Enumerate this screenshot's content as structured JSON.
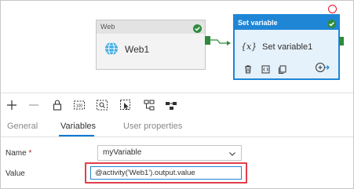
{
  "canvas": {
    "web_activity": {
      "type_label": "Web",
      "name": "Web1"
    },
    "set_variable_activity": {
      "type_label": "Set variable",
      "fx_symbol": "{x}",
      "name": "Set variable1"
    }
  },
  "toolbar": {
    "items": [
      "add-icon",
      "remove-icon",
      "lock-icon",
      "zoom-100-icon",
      "zoom-fit-icon",
      "select-icon",
      "auto-align-icon",
      "layout-icon"
    ]
  },
  "tabs": [
    {
      "label": "General",
      "active": false
    },
    {
      "label": "Variables",
      "active": true
    },
    {
      "label": "User properties",
      "active": false
    }
  ],
  "form": {
    "name_label": "Name",
    "name_required_mark": "*",
    "name_value": "myVariable",
    "value_label": "Value",
    "value_text": "@activity('Web1').output.value"
  },
  "colors": {
    "accent": "#1f86d6",
    "success": "#2e8b3e",
    "highlight": "#e0404a"
  }
}
